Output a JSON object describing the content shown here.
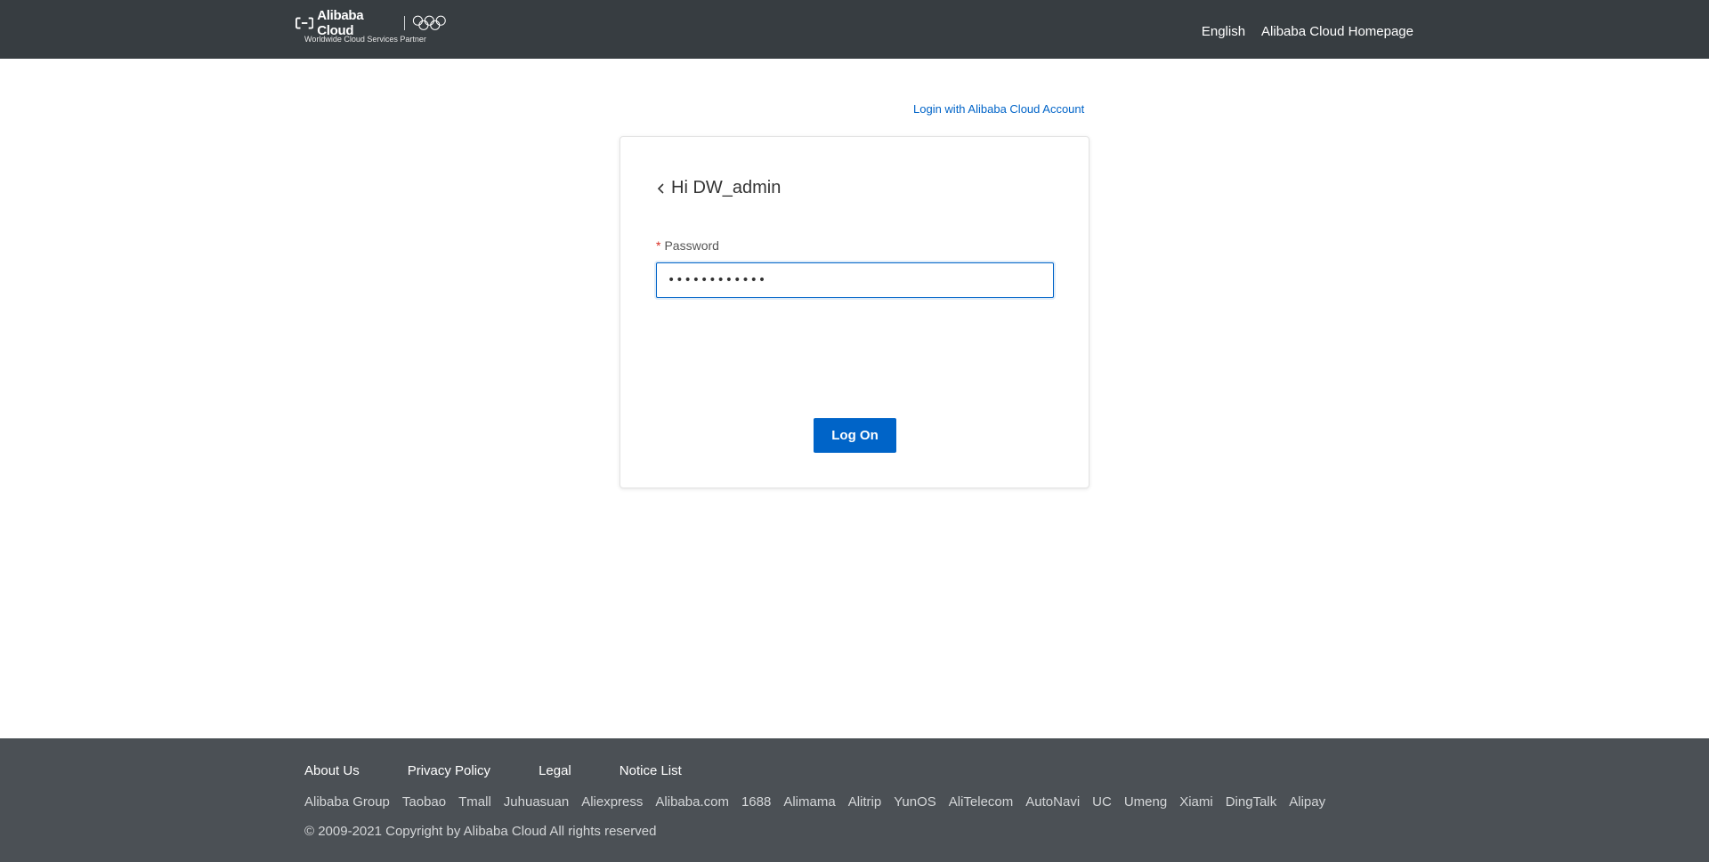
{
  "header": {
    "brand_name": "Alibaba Cloud",
    "brand_tagline": "Worldwide Cloud Services Partner",
    "nav": [
      {
        "label": "English"
      },
      {
        "label": "Alibaba Cloud Homepage"
      }
    ]
  },
  "login": {
    "alt_login_link": "Login with Alibaba Cloud Account",
    "greeting": "Hi DW_admin",
    "password_required_mark": "*",
    "password_label": "Password",
    "password_value": "••••••••••••",
    "submit_label": "Log On"
  },
  "footer": {
    "main_links": [
      {
        "label": "About Us"
      },
      {
        "label": "Privacy Policy"
      },
      {
        "label": "Legal"
      },
      {
        "label": "Notice List"
      }
    ],
    "sites": [
      "Alibaba Group",
      "Taobao",
      "Tmall",
      "Juhuasuan",
      "Aliexpress",
      "Alibaba.com",
      "1688",
      "Alimama",
      "Alitrip",
      "YunOS",
      "AliTelecom",
      "AutoNavi",
      "UC",
      "Umeng",
      "Xiami",
      "DingTalk",
      "Alipay"
    ],
    "copyright": "© 2009-2021 Copyright by Alibaba Cloud All rights reserved"
  },
  "colors": {
    "header_bg": "#373d41",
    "footer_bg": "#4b5055",
    "accent": "#0064c8",
    "required": "#d93026"
  },
  "icons": {
    "logo": "alibaba-cloud-logo-icon",
    "olympic": "olympic-rings-icon",
    "back": "chevron-left-icon"
  }
}
